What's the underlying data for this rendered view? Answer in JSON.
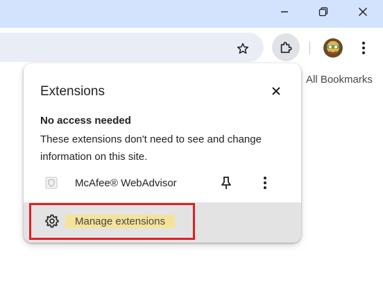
{
  "window": {
    "controls": [
      "minimize-icon",
      "restore-icon",
      "close-icon"
    ]
  },
  "toolbar": {
    "icons": [
      "star-icon",
      "puzzle-extensions-icon",
      "avatar",
      "more-vert-icon"
    ]
  },
  "bookmarks_bar": {
    "all_bookmarks_label": "All Bookmarks"
  },
  "extensions_panel": {
    "title": "Extensions",
    "section_heading": "No access needed",
    "section_description": "These extensions don't need to see and change information on this site.",
    "extensions": [
      {
        "name": "McAfee® WebAdvisor",
        "icon": "mcafee-shield-icon"
      }
    ],
    "manage_label": "Manage extensions"
  },
  "colors": {
    "titlebar": "#d3e3fd",
    "omnibox": "#e9eef6",
    "footer": "#e3e3e3",
    "highlight_border": "#e01e26",
    "text_highlight": "#f5e39a"
  }
}
